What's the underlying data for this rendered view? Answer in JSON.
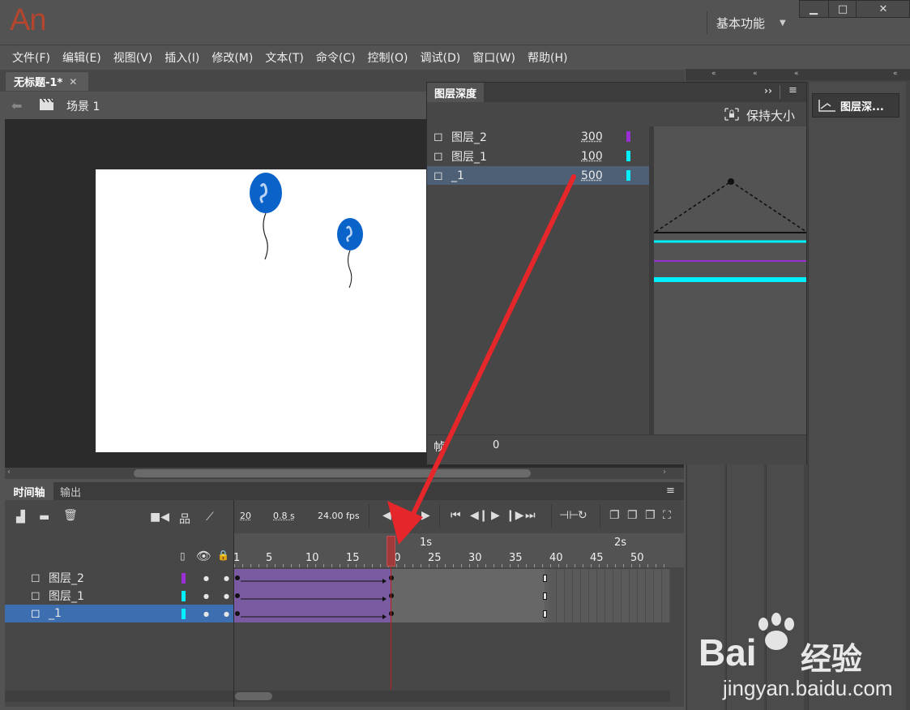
{
  "app": {
    "logo": "An",
    "workspace": "基本功能"
  },
  "window_controls": {
    "minimize": "▁",
    "maximize": "□",
    "close": "✕"
  },
  "menu": [
    "文件(F)",
    "编辑(E)",
    "视图(V)",
    "插入(I)",
    "修改(M)",
    "文本(T)",
    "命令(C)",
    "控制(O)",
    "调试(D)",
    "窗口(W)",
    "帮助(H)"
  ],
  "document": {
    "tab_title": "无标题-1*",
    "close_glyph": "✕",
    "scene": "场景 1"
  },
  "layer_depth_panel": {
    "title": "图层深度",
    "keep_size": "保持大小",
    "layers": [
      {
        "name": "图层_2",
        "depth": "300",
        "color": "#9b2fd6",
        "selected": false
      },
      {
        "name": "图层_1",
        "depth": "100",
        "color": "#00f0ff",
        "selected": false
      },
      {
        "name": "_1",
        "depth": "500",
        "color": "#00f0ff",
        "selected": true
      }
    ],
    "frame_label": "帧",
    "frame_value": "0"
  },
  "right_panel": {
    "button_label": "图层深..."
  },
  "timeline": {
    "tabs": [
      "时间轴",
      "输出"
    ],
    "current_frame": "20",
    "elapsed": "0.8 s",
    "fps": "24.00 fps",
    "ruler_numbers": [
      "1",
      "5",
      "10",
      "15",
      "20",
      "25",
      "30",
      "35",
      "40",
      "45",
      "50"
    ],
    "time_markers": [
      "1s",
      "2s"
    ],
    "layers": [
      {
        "name": "图层_2",
        "color": "#9b2fd6",
        "selected": false
      },
      {
        "name": "图层_1",
        "color": "#00f0ff",
        "selected": false
      },
      {
        "name": "_1",
        "color": "#00f0ff",
        "selected": true
      }
    ]
  },
  "watermark": {
    "brand": "Bai",
    "brand_cn": "经验",
    "url": "jingyan.baidu.com"
  },
  "colors": {
    "accent_red": "#e5262a",
    "balloon_blue": "#0a63c9",
    "selection_blue": "#3d6fb0"
  }
}
